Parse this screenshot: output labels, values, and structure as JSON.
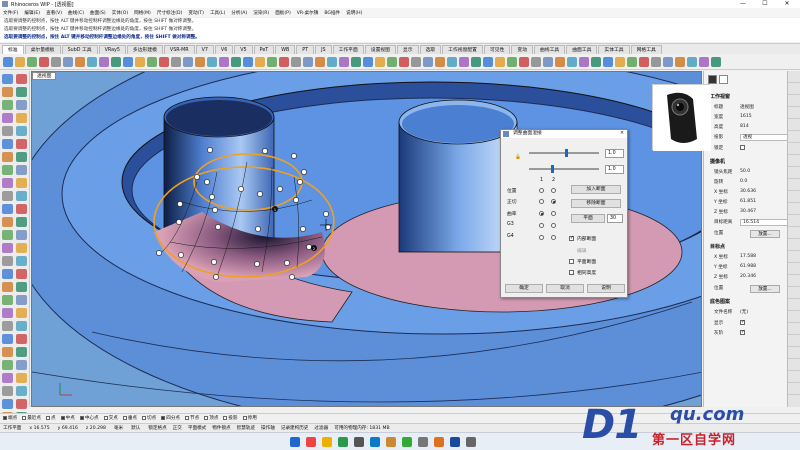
{
  "window": {
    "title": "Rhinoceros WIP - [透视图]"
  },
  "menu": [
    "文件(F)",
    "编辑(E)",
    "查看(V)",
    "曲线(C)",
    "曲面(S)",
    "实体(O)",
    "网格(M)",
    "尺寸标注(D)",
    "变动(T)",
    "工具(L)",
    "分析(A)",
    "渲染(R)",
    "面板(P)",
    "VR-桌尔镇",
    "BG插件",
    "说明(H)"
  ],
  "command": {
    "line1": "选取要调整的控制点，按住 ALT 键并移动控制杆调整边缘处的角度，按住 SHIFT 做对称调整。",
    "line2": "选取要调整的控制点，按住 ALT 键并移动控制杆调整边缘处的角度，按住 SHIFT 做对称调整。",
    "line3": "选取要调整的控制点，按住 ALT 键并移动控制杆调整边缘处的角度，按住 SHIFT 做对称调整。"
  },
  "tabs": [
    "标准",
    "桌尔量模板",
    "SubD 工具",
    "VRay5",
    "多边形建模",
    "VSR-MR",
    "V7",
    "V6",
    "V5",
    "PeT",
    "WB",
    "PT",
    "JS",
    "工作平面",
    "设置视图",
    "显示",
    "选取",
    "工作视窗配置",
    "可见性",
    "变动",
    "曲线工具",
    "曲面工具",
    "实体工具",
    "网格工具"
  ],
  "active_tab": "标准",
  "viewport": {
    "label": "透视图"
  },
  "dialog": {
    "title": "调整曲面混接",
    "slider1_value": "1.0",
    "slider2_value": "1.0",
    "col1": "1",
    "col2": "2",
    "rows": [
      "位置",
      "正切",
      "曲率",
      "G3",
      "G4"
    ],
    "btn_add": "加入断面",
    "btn_remove": "移除断面",
    "btn_flat": "平面",
    "flat_value": "30",
    "check_inner": "内部断面",
    "edge_label": "编辑",
    "check_flat_section": "平面断面",
    "check_same_height": "相同高度",
    "ok": "确定",
    "cancel": "取消",
    "help": "说明"
  },
  "panel": {
    "section_view": "工作视窗",
    "title_k": "标题",
    "title_v": "透视图",
    "width_k": "宽度",
    "width_v": "1615",
    "height_k": "高度",
    "height_v": "814",
    "proj_k": "投影",
    "proj_v": "透视",
    "lock_k": "锁定",
    "section_cam": "摄像机",
    "lens_k": "镜头焦距",
    "lens_v": "50.0",
    "rot_k": "旋转",
    "rot_v": "0.0",
    "cx_k": "X 坐标",
    "cx_v": "30.636",
    "cy_k": "Y 坐标",
    "cy_v": "61.851",
    "cz_k": "Z 坐标",
    "cz_v": "30.467",
    "dist_k": "目标距离",
    "dist_v": "16.514",
    "pos_k": "位置",
    "pos_btn": "放置...",
    "section_target": "目标点",
    "tx_k": "X 坐标",
    "tx_v": "17.588",
    "ty_k": "Y 坐标",
    "ty_v": "61.988",
    "tz_k": "Z 坐标",
    "tz_v": "20.346",
    "tpos_k": "位置",
    "tpos_btn": "放置...",
    "section_bg": "底色图案",
    "file_k": "文件名称",
    "file_v": "(无)",
    "show_k": "显示",
    "gray_k": "灰阶"
  },
  "osnap": [
    "端点",
    "最近点",
    "点",
    "中点",
    "中心点",
    "交点",
    "垂点",
    "切点",
    "四分点",
    "节点",
    "顶点",
    "投影",
    "停用"
  ],
  "osnap_on": [
    true,
    false,
    false,
    true,
    true,
    false,
    false,
    false,
    true,
    false,
    false,
    false,
    false
  ],
  "status": {
    "plane": "工作平面",
    "x": "x 16.575",
    "y": "y 69.416",
    "z": "z 20.298",
    "unit": "毫米",
    "layer": "默认",
    "items": [
      "锁定格点",
      "正交",
      "平面模式",
      "物件锁点",
      "智慧轨迹",
      "操作轴",
      "记录建构历史",
      "过滤器",
      "可用的物理内存: 1831 MB"
    ]
  },
  "watermark": {
    "brand": "D1",
    "site": "qu.com",
    "sub": "第一区自学网"
  },
  "colors": {
    "viewport_bg": "#6fa0d6",
    "surface": "#5b8fdb",
    "pink": "#d79ab0",
    "accent": "#1a66c8",
    "orange": "#f0a020"
  }
}
